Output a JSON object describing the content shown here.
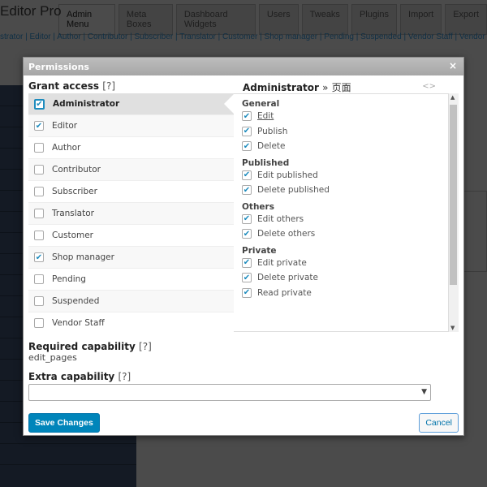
{
  "background": {
    "app_title": "Editor Pro",
    "tabs": [
      "Admin Menu",
      "Meta Boxes",
      "Dashboard Widgets",
      "Users",
      "Tweaks",
      "Plugins",
      "Import",
      "Export"
    ],
    "roles_line": "strator | Editor | Author | Contributor | Subscriber | Translator | Customer | Shop manager | Pending | Suspended | Vendor Staff | Vendor |"
  },
  "dialog": {
    "title": "Permissions",
    "close": "×",
    "grant_access": {
      "label": "Grant access",
      "help": "[?]"
    },
    "roles": [
      {
        "name": "Administrator",
        "checked": true,
        "selected": true
      },
      {
        "name": "Editor",
        "checked": true
      },
      {
        "name": "Author",
        "checked": false
      },
      {
        "name": "Contributor",
        "checked": false
      },
      {
        "name": "Subscriber",
        "checked": false
      },
      {
        "name": "Translator",
        "checked": false
      },
      {
        "name": "Customer",
        "checked": false
      },
      {
        "name": "Shop manager",
        "checked": true
      },
      {
        "name": "Pending",
        "checked": false
      },
      {
        "name": "Suspended",
        "checked": false
      },
      {
        "name": "Vendor Staff",
        "checked": false
      }
    ],
    "detail": {
      "role": "Administrator",
      "sep": "»",
      "item": "页面",
      "code_icon": "<>",
      "groups": [
        {
          "name": "General",
          "caps": [
            "Edit",
            "Publish",
            "Delete"
          ]
        },
        {
          "name": "Published",
          "caps": [
            "Edit published",
            "Delete published"
          ]
        },
        {
          "name": "Others",
          "caps": [
            "Edit others",
            "Delete others"
          ]
        },
        {
          "name": "Private",
          "caps": [
            "Edit private",
            "Delete private",
            "Read private"
          ]
        }
      ]
    },
    "required": {
      "label": "Required capability",
      "help": "[?]",
      "value": "edit_pages"
    },
    "extra": {
      "label": "Extra capability",
      "help": "[?]",
      "value": ""
    },
    "save": "Save Changes",
    "cancel": "Cancel",
    "accent": "#0085ba"
  }
}
